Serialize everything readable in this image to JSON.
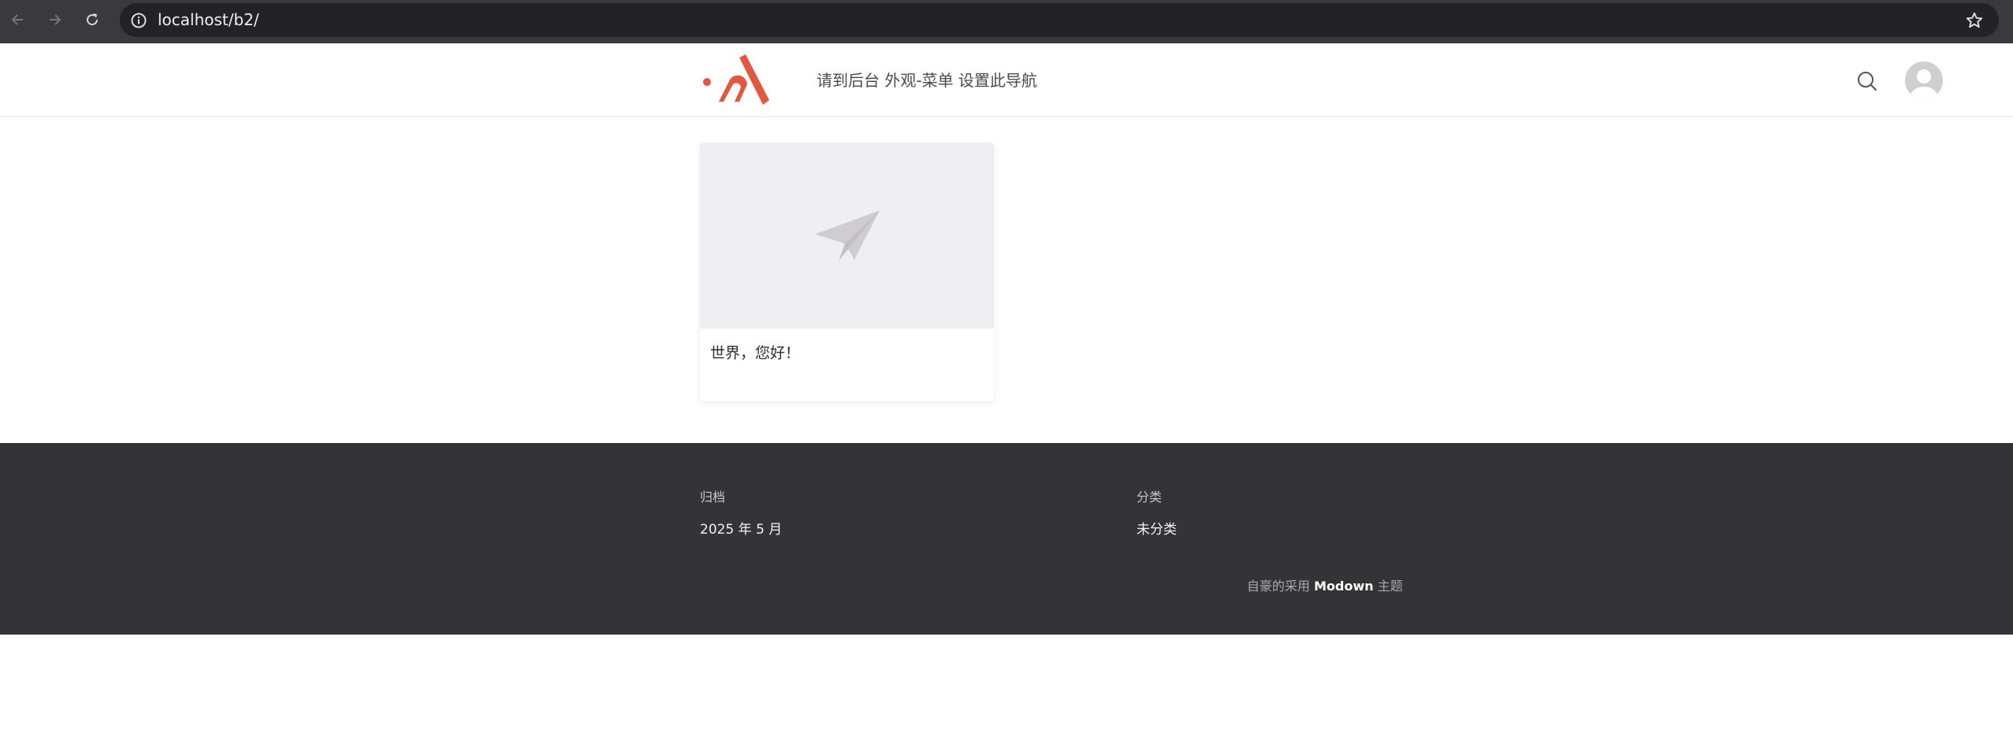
{
  "browser": {
    "url": "localhost/b2/",
    "icons": {
      "back": "arrow-left-icon",
      "forward": "arrow-right-icon",
      "reload": "reload-icon",
      "site_info": "info-circle-icon",
      "bookmark": "star-icon"
    }
  },
  "header": {
    "logo_alt": "site logo",
    "nav_text": "请到后台 外观-菜单 设置此导航",
    "search_icon": "search-icon",
    "avatar_icon": "user-avatar-icon"
  },
  "posts": [
    {
      "title": "世界，您好！",
      "thumbnail_icon": "paper-plane-icon"
    }
  ],
  "footer": {
    "widgets": [
      {
        "title": "归档",
        "items": [
          "2025 年 5 月"
        ]
      },
      {
        "title": "分类",
        "items": [
          "未分类"
        ]
      }
    ],
    "copyright": {
      "prefix": "自豪的采用",
      "theme_name": "Modown",
      "suffix": "主题"
    }
  },
  "colors": {
    "brand": "#e2583e",
    "footer_bg": "#343336",
    "chrome_bg": "#3a393d"
  }
}
